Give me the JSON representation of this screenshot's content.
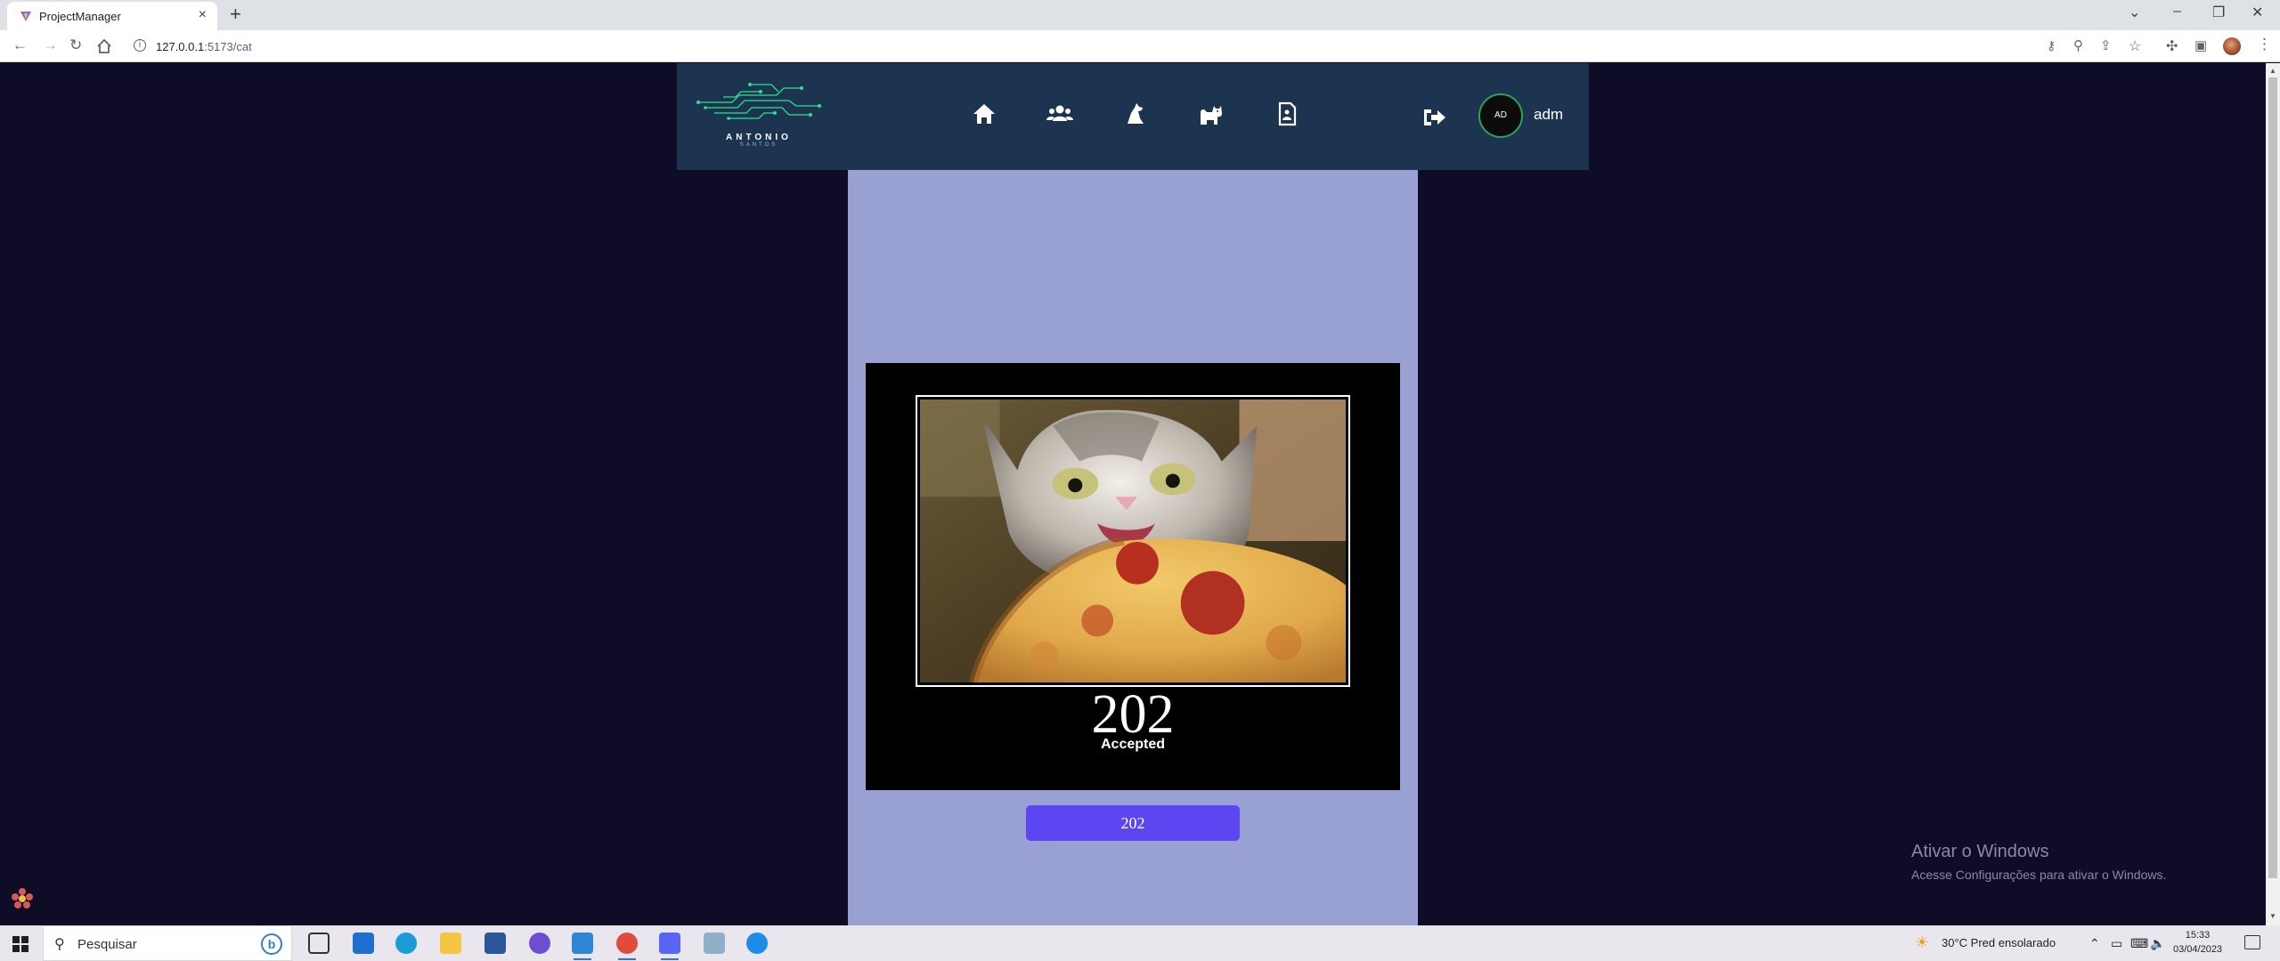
{
  "browser": {
    "tab_title": "ProjectManager",
    "tab_close": "×",
    "new_tab": "+",
    "url_host": "127.0.0.1",
    "url_rest": ":5173/cat",
    "win_minimize": "–",
    "win_restore": "❐",
    "win_close": "✕",
    "tab_list": "⌄"
  },
  "navbar": {
    "logo_text": "ANTONIO",
    "logo_sub": "SANTOS",
    "items": [
      {
        "name": "home",
        "icon": "home-icon"
      },
      {
        "name": "users",
        "icon": "users-icon"
      },
      {
        "name": "dog",
        "icon": "dog-icon"
      },
      {
        "name": "cat",
        "icon": "cat-icon"
      },
      {
        "name": "report",
        "icon": "report-icon"
      }
    ],
    "logout_icon": "logout-icon",
    "avatar_initials": "AD",
    "username": "adm"
  },
  "cat_card": {
    "code": "202",
    "status": "Accepted"
  },
  "code_button_label": "202",
  "watermark": {
    "line1": "Ativar o Windows",
    "line2": "Acesse Configurações para ativar o Windows."
  },
  "taskbar": {
    "search_placeholder": "Pesquisar",
    "bing_label": "b",
    "weather": "30°C  Pred ensolarado",
    "time": "15:33",
    "date": "03/04/2023"
  },
  "colors": {
    "page_bg": "#0e0c27",
    "navbar_bg": "#1c3450",
    "content_bg": "#99a1d2",
    "button_bg": "#5c46f2",
    "avatar_ring": "#2aa35b"
  }
}
